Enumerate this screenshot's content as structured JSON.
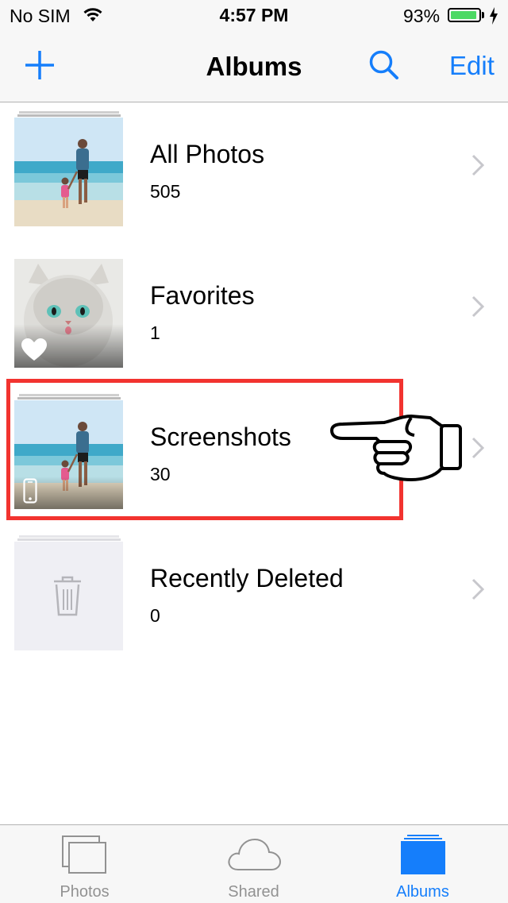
{
  "status_bar": {
    "carrier": "No SIM",
    "time": "4:57 PM",
    "battery_percent": "93%",
    "battery_level": 0.93,
    "battery_color": "#4cd964"
  },
  "nav": {
    "title": "Albums",
    "add_icon": "plus-icon",
    "search_icon": "search-icon",
    "edit_label": "Edit",
    "accent_color": "#157efb"
  },
  "albums": [
    {
      "title": "All Photos",
      "count": "505",
      "thumb": "beach-father-child-photo",
      "badge": ""
    },
    {
      "title": "Favorites",
      "count": "1",
      "thumb": "white-kitten-photo",
      "badge": "heart-icon"
    },
    {
      "title": "Screenshots",
      "count": "30",
      "thumb": "beach-father-child-photo",
      "badge": "phone-icon"
    },
    {
      "title": "Recently Deleted",
      "count": "0",
      "thumb": "empty",
      "badge": "trash-icon"
    }
  ],
  "annotation": {
    "highlighted_album": "Screenshots",
    "highlight_color": "#f2332f",
    "pointer": "pointing-hand-icon"
  },
  "tab_bar": {
    "tabs": [
      {
        "label": "Photos",
        "icon": "photos-tab-icon",
        "active": false
      },
      {
        "label": "Shared",
        "icon": "cloud-icon",
        "active": false
      },
      {
        "label": "Albums",
        "icon": "albums-tab-icon",
        "active": true
      }
    ],
    "active_color": "#157efb",
    "inactive_color": "#929292"
  }
}
